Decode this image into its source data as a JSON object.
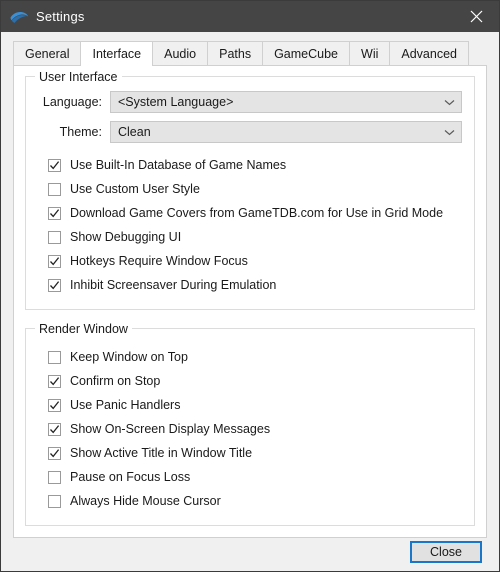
{
  "window": {
    "title": "Settings",
    "app_icon": "dolphin-icon",
    "close_icon": "close-icon",
    "accent_color": "#1976c8",
    "titlebar_color": "#454545"
  },
  "tabs": [
    {
      "label": "General",
      "active": false
    },
    {
      "label": "Interface",
      "active": true
    },
    {
      "label": "Audio",
      "active": false
    },
    {
      "label": "Paths",
      "active": false
    },
    {
      "label": "GameCube",
      "active": false
    },
    {
      "label": "Wii",
      "active": false
    },
    {
      "label": "Advanced",
      "active": false
    }
  ],
  "user_interface": {
    "title": "User Interface",
    "fields": [
      {
        "label": "Language:",
        "value": "<System Language>",
        "icon": "chevron-down-icon"
      },
      {
        "label": "Theme:",
        "value": "Clean",
        "icon": "chevron-down-icon"
      }
    ],
    "checkboxes": [
      {
        "label": "Use Built-In Database of Game Names",
        "checked": true
      },
      {
        "label": "Use Custom User Style",
        "checked": false
      },
      {
        "label": "Download Game Covers from GameTDB.com for Use in Grid Mode",
        "checked": true
      },
      {
        "label": "Show Debugging UI",
        "checked": false
      },
      {
        "label": "Hotkeys Require Window Focus",
        "checked": true
      },
      {
        "label": "Inhibit Screensaver During Emulation",
        "checked": true
      }
    ]
  },
  "render_window": {
    "title": "Render Window",
    "checkboxes": [
      {
        "label": "Keep Window on Top",
        "checked": false
      },
      {
        "label": "Confirm on Stop",
        "checked": true
      },
      {
        "label": "Use Panic Handlers",
        "checked": true
      },
      {
        "label": "Show On-Screen Display Messages",
        "checked": true
      },
      {
        "label": "Show Active Title in Window Title",
        "checked": true
      },
      {
        "label": "Pause on Focus Loss",
        "checked": false
      },
      {
        "label": "Always Hide Mouse Cursor",
        "checked": false
      }
    ]
  },
  "footer": {
    "close_label": "Close"
  }
}
